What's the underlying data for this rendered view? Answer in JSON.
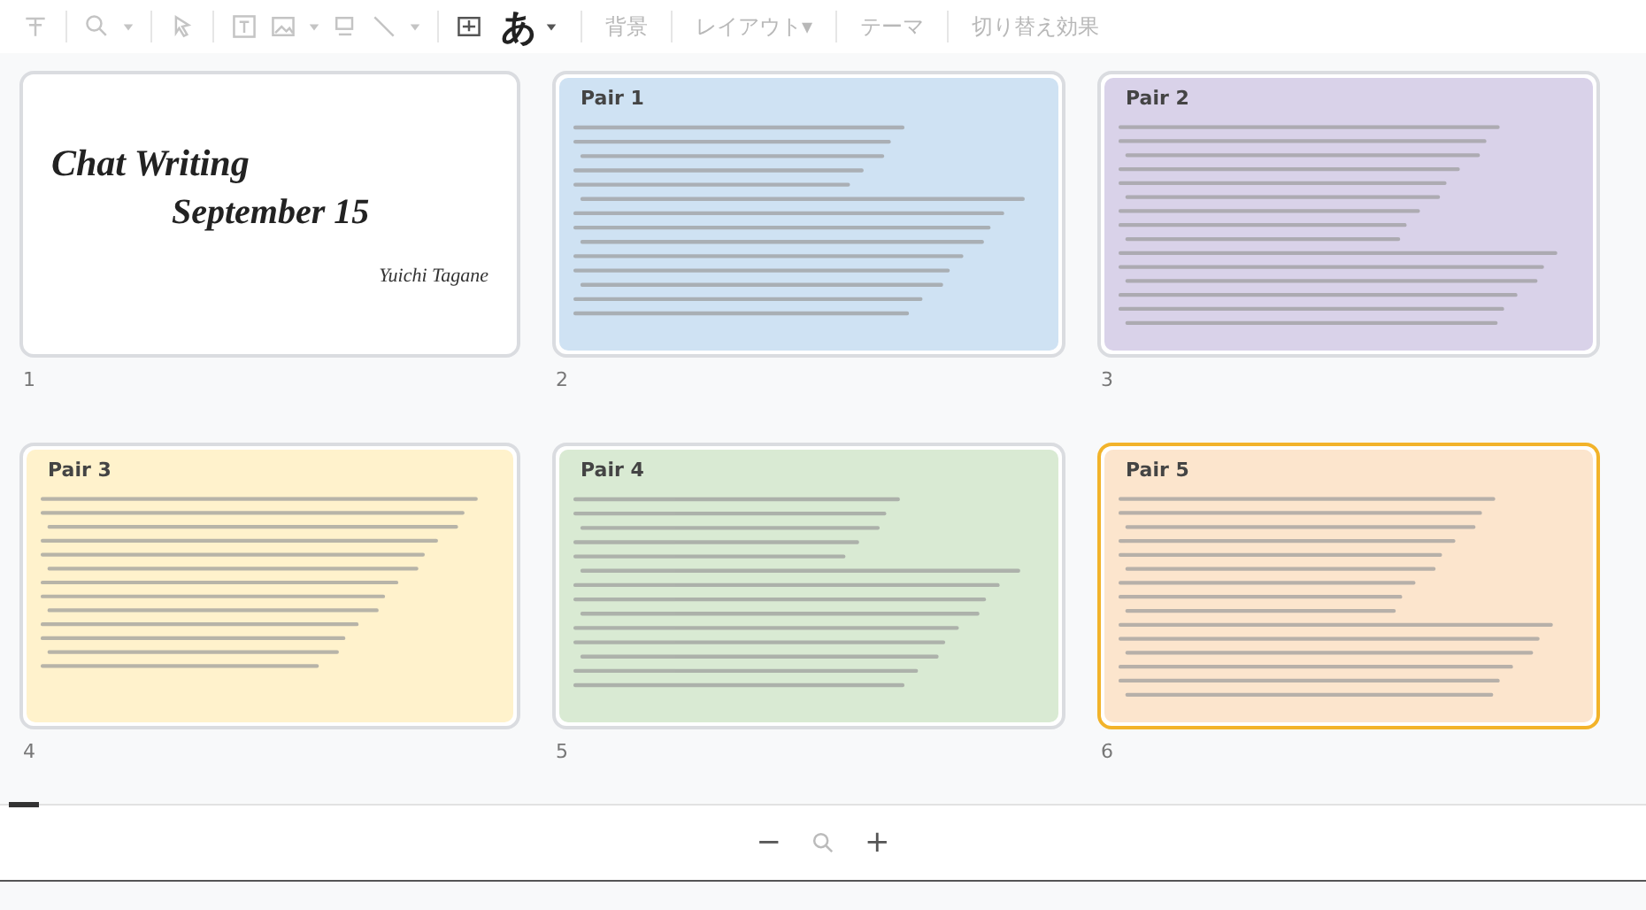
{
  "toolbar": {
    "input_button": {
      "label": "あ",
      "disabled": false
    },
    "buttons": [
      {
        "label": "背景",
        "disabled": true
      },
      {
        "label": "レイアウト▾",
        "disabled": true
      },
      {
        "label": "テーマ",
        "disabled": true
      },
      {
        "label": "切り替え効果",
        "disabled": true
      }
    ]
  },
  "slides": [
    {
      "kind": "title",
      "number": "1",
      "selected": false,
      "color": "#ffffff",
      "title": "Chat Writing",
      "subtitle": "September 15",
      "author": "Yuichi Tagane"
    },
    {
      "kind": "pair",
      "number": "2",
      "selected": false,
      "color": "#cfe2f3",
      "title": "Pair 1"
    },
    {
      "kind": "pair",
      "number": "3",
      "selected": false,
      "color": "#d9d2e9",
      "title": "Pair 2"
    },
    {
      "kind": "pair",
      "number": "4",
      "selected": false,
      "color": "#fff2cc",
      "title": "Pair 3"
    },
    {
      "kind": "pair",
      "number": "5",
      "selected": false,
      "color": "#d9ead3",
      "title": "Pair 4"
    },
    {
      "kind": "pair",
      "number": "6",
      "selected": true,
      "color": "#fce5cd",
      "title": "Pair 5"
    }
  ],
  "zoom_bar": {
    "minus": "−",
    "plus": "+"
  }
}
